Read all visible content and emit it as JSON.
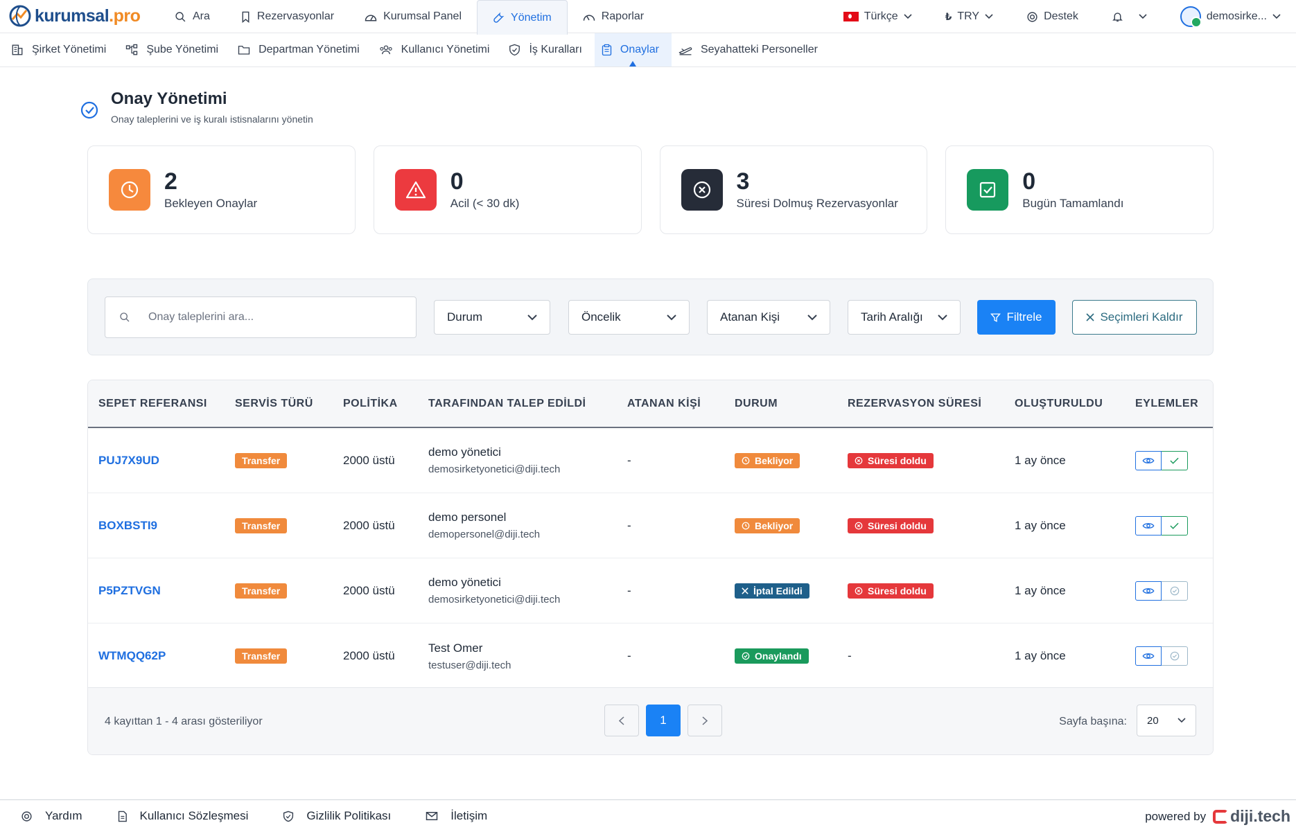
{
  "brand": {
    "name": "kurumsal",
    "suffix": ".pro"
  },
  "topnav": {
    "tabs": [
      {
        "label": "Ara",
        "icon": "search-icon"
      },
      {
        "label": "Rezervasyonlar",
        "icon": "bookmark-icon"
      },
      {
        "label": "Kurumsal Panel",
        "icon": "dashboard-icon"
      },
      {
        "label": "Yönetim",
        "icon": "wrench-icon",
        "active": true
      },
      {
        "label": "Raporlar",
        "icon": "gauge-icon"
      }
    ],
    "language": "Türkçe",
    "currency": "TRY",
    "support": "Destek",
    "user": "demosirke..."
  },
  "subnav": {
    "items": [
      {
        "label": "Şirket Yönetimi",
        "icon": "building-icon"
      },
      {
        "label": "Şube Yönetimi",
        "icon": "branches-icon"
      },
      {
        "label": "Departman Yönetimi",
        "icon": "folder-icon"
      },
      {
        "label": "Kullanıcı Yönetimi",
        "icon": "users-icon"
      },
      {
        "label": "İş Kuralları",
        "icon": "shield-check-icon"
      },
      {
        "label": "Onaylar",
        "icon": "clipboard-icon",
        "active": true
      },
      {
        "label": "Seyahatteki Personeller",
        "icon": "plane-icon"
      }
    ]
  },
  "page": {
    "title": "Onay Yönetimi",
    "subtitle": "Onay taleplerini ve iş kuralı istisnalarını yönetin"
  },
  "stats": [
    {
      "value": "2",
      "label": "Bekleyen Onaylar",
      "color": "#f6893d",
      "icon": "clock-icon"
    },
    {
      "value": "0",
      "label": "Acil (< 30 dk)",
      "color": "#ec3a3f",
      "icon": "warning-icon"
    },
    {
      "value": "3",
      "label": "Süresi Dolmuş Rezervasyonlar",
      "color": "#262c38",
      "icon": "x-circle-icon"
    },
    {
      "value": "0",
      "label": "Bugün Tamamlandı",
      "color": "#179a5e",
      "icon": "check-square-icon"
    }
  ],
  "filters": {
    "search_placeholder": "Onay taleplerini ara...",
    "status": "Durum",
    "priority": "Öncelik",
    "assignee": "Atanan Kişi",
    "date_range": "Tarih Aralığı",
    "filter_button": "Filtrele",
    "clear_button": "Seçimleri Kaldır"
  },
  "table": {
    "headers": [
      "SEPET REFERANSI",
      "SERVİS TÜRÜ",
      "POLİTİKA",
      "TARAFINDAN TALEP EDİLDİ",
      "ATANAN KİŞİ",
      "DURUM",
      "REZERVASYON SÜRESİ",
      "OLUŞTURULDU",
      "EYLEMLER"
    ],
    "rows": [
      {
        "ref": "PUJ7X9UD",
        "service": "Transfer",
        "policy": "2000 üstü",
        "requester_name": "demo yönetici",
        "requester_email": "demosirketyonetici@diji.tech",
        "assignee": "-",
        "status": "Bekliyor",
        "duration": "Süresi doldu",
        "created": "1 ay önce"
      },
      {
        "ref": "BOXBSTI9",
        "service": "Transfer",
        "policy": "2000 üstü",
        "requester_name": "demo personel",
        "requester_email": "demopersonel@diji.tech",
        "assignee": "-",
        "status": "Bekliyor",
        "duration": "Süresi doldu",
        "created": "1 ay önce"
      },
      {
        "ref": "P5PZTVGN",
        "service": "Transfer",
        "policy": "2000 üstü",
        "requester_name": "demo yönetici",
        "requester_email": "demosirketyonetici@diji.tech",
        "assignee": "-",
        "status": "İptal Edildi",
        "duration": "Süresi doldu",
        "created": "1 ay önce"
      },
      {
        "ref": "WTMQQ62P",
        "service": "Transfer",
        "policy": "2000 üstü",
        "requester_name": "Test Omer",
        "requester_email": "testuser@diji.tech",
        "assignee": "-",
        "status": "Onaylandı",
        "duration": "-",
        "created": "1 ay önce"
      }
    ]
  },
  "pagination": {
    "info": "4 kayıttan 1 - 4 arası gösteriliyor",
    "current_page": "1",
    "per_page_label": "Sayfa başına:",
    "per_page": "20"
  },
  "footer": {
    "items": [
      {
        "label": "Yardım",
        "icon": "lifebuoy-icon"
      },
      {
        "label": "Kullanıcı Sözleşmesi",
        "icon": "document-icon"
      },
      {
        "label": "Gizlilik Politikası",
        "icon": "shield-icon"
      },
      {
        "label": "İletişim",
        "icon": "mail-icon"
      }
    ],
    "powered_by": "powered by",
    "powered_brand": "diji.tech"
  }
}
